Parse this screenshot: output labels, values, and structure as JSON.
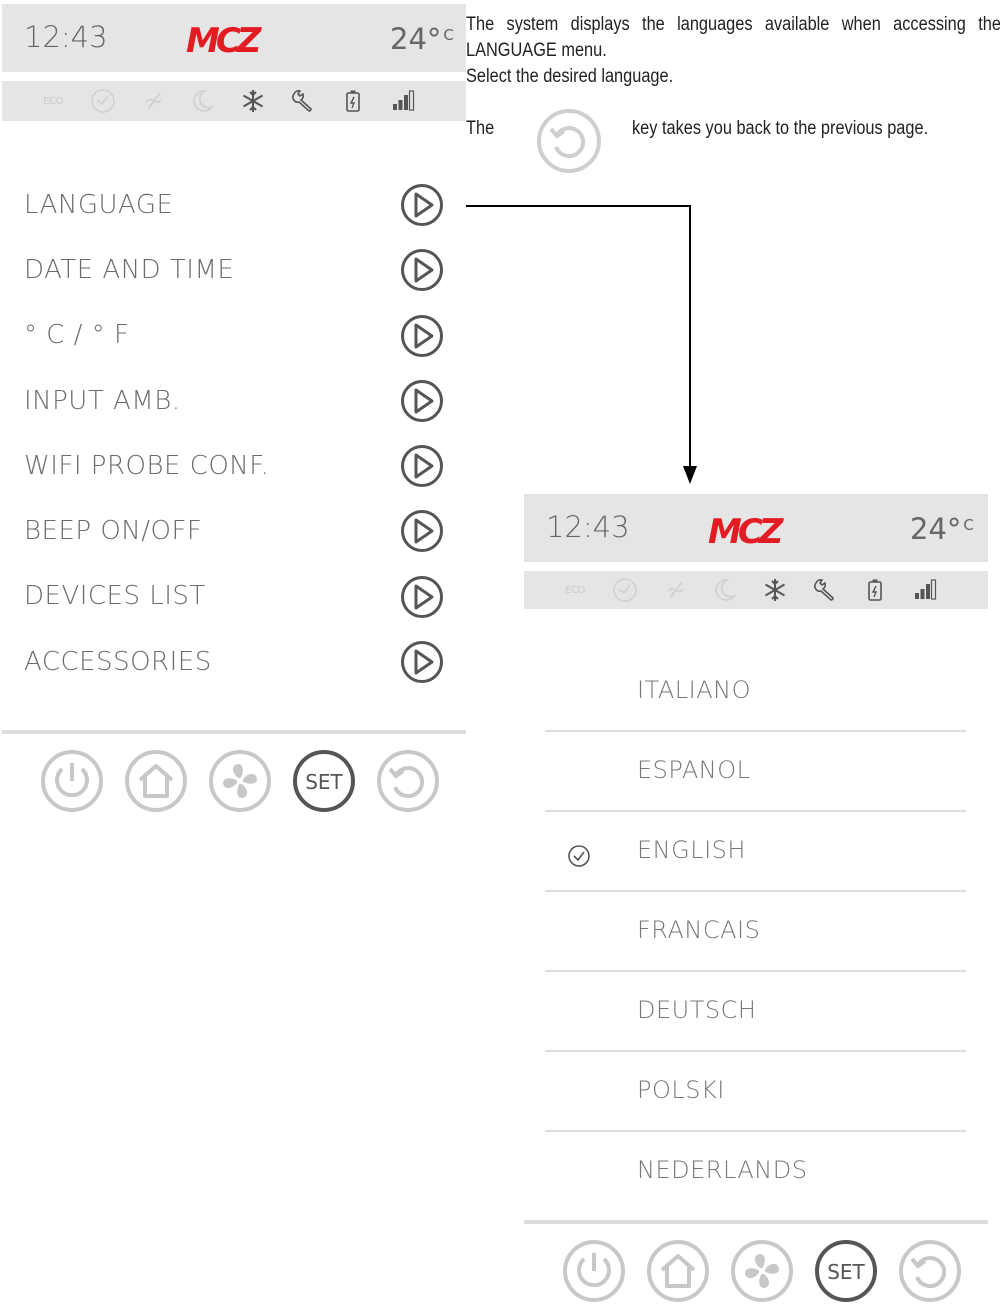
{
  "left_screen": {
    "time": "12:43",
    "brand": "MCZ",
    "temp": "24°",
    "temp_unit": "C",
    "eco_label": "ECO",
    "status_icons": [
      "eco-indicator",
      "clock-icon",
      "fan-off-icon",
      "moon-icon",
      "snowflake-icon",
      "wrench-icon",
      "battery-icon",
      "signal-icon"
    ],
    "menu_items": [
      {
        "label": "LANGUAGE"
      },
      {
        "label": "DATE AND TIME"
      },
      {
        "label": "° C / ° F"
      },
      {
        "label": "INPUT AMB."
      },
      {
        "label": "WIFI PROBE CONF."
      },
      {
        "label": "BEEP ON/OFF"
      },
      {
        "label": "DEVICES LIST"
      },
      {
        "label": "ACCESSORIES"
      }
    ],
    "bottom_buttons": {
      "set_label": "SET"
    }
  },
  "description": {
    "line1": "The system displays the languages available when accessing the LANGUAGE menu.",
    "line2": "Select the desired language.",
    "back_prefix": "The",
    "back_suffix": "key takes you back to the previous page."
  },
  "right_screen": {
    "time": "12:43",
    "brand": "MCZ",
    "temp": "24°",
    "temp_unit": "C",
    "eco_label": "ECO",
    "languages": [
      {
        "label": "ITALIANO",
        "selected": false
      },
      {
        "label": "ESPANOL",
        "selected": false
      },
      {
        "label": "ENGLISH",
        "selected": true
      },
      {
        "label": "FRANCAIS",
        "selected": false
      },
      {
        "label": "DEUTSCH",
        "selected": false
      },
      {
        "label": "POLSKI",
        "selected": false
      },
      {
        "label": "NEDERLANDS",
        "selected": false
      }
    ],
    "bottom_buttons": {
      "set_label": "SET"
    }
  },
  "colors": {
    "brand_red": "#e31b23",
    "header_bg": "#e5e5e5",
    "icon_gray": "#9a9a9a",
    "button_gray": "#c8c8c8",
    "active_button": "#555555"
  }
}
